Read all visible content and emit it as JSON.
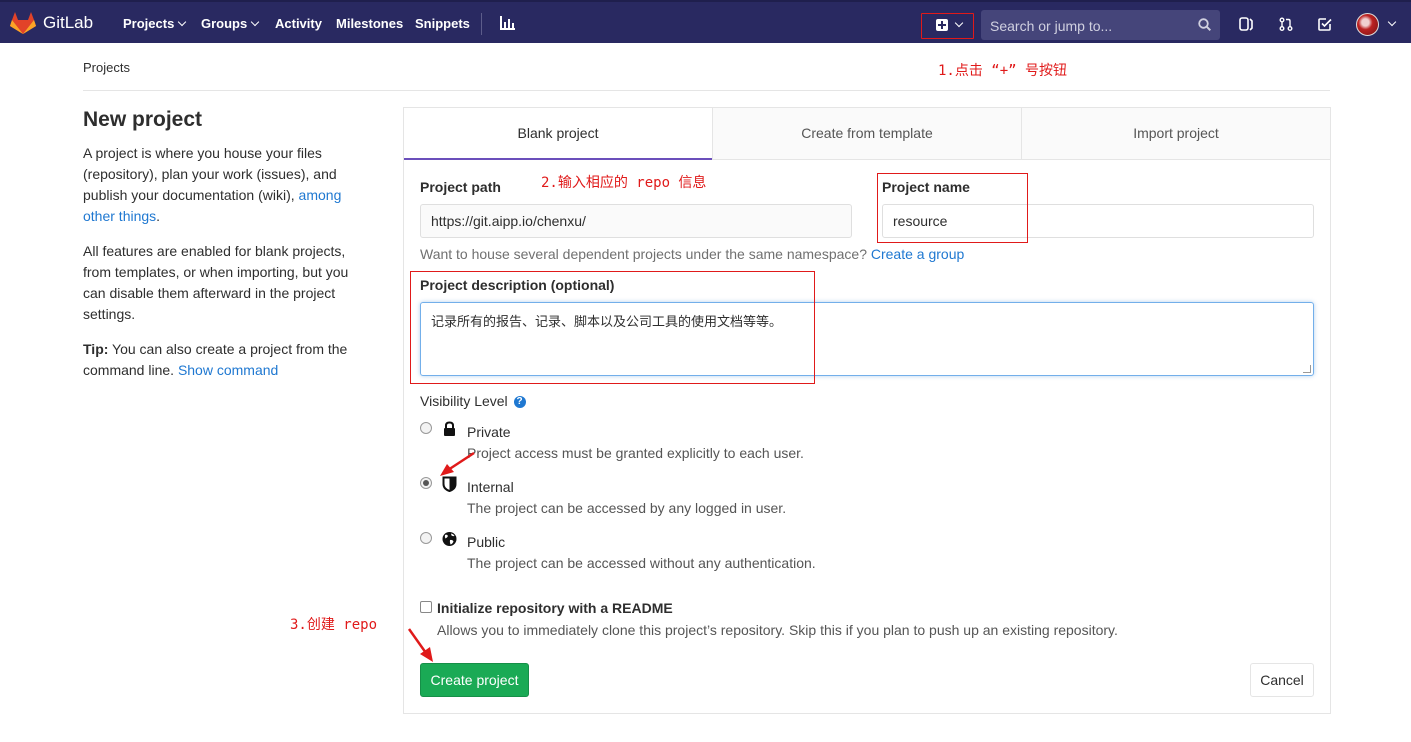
{
  "app": {
    "name": "GitLab",
    "nav": [
      "Projects",
      "Groups",
      "Activity",
      "Milestones",
      "Snippets"
    ],
    "search_placeholder": "Search or jump to..."
  },
  "breadcrumb": "Projects",
  "annotations": {
    "step1": "1.点击 “+” 号按钮",
    "step2": "2.输入相应的 repo 信息",
    "step3": "3.创建 repo"
  },
  "sidebar": {
    "title": "New project",
    "intro": "A project is where you house your files (repository), plan your work (issues), and publish your documentation (wiki),",
    "intro_link": "among other things",
    "features": "All features are enabled for blank projects, from templates, or when importing, but you can disable them afterward in the project settings.",
    "tip_label": "Tip:",
    "tip_text": "You can also create a project from the command line.",
    "tip_link": "Show command"
  },
  "tabs": [
    "Blank project",
    "Create from template",
    "Import project"
  ],
  "form": {
    "path_label": "Project path",
    "path_value": "https://git.aipp.io/chenxu/",
    "name_label": "Project name",
    "name_value": "resource",
    "group_help": "Want to house several dependent projects under the same namespace?",
    "group_link": "Create a group",
    "desc_label": "Project description (optional)",
    "desc_value": "记录所有的报告、记录、脚本以及公司工具的使用文档等等。",
    "visibility_label": "Visibility Level",
    "visibility": [
      {
        "label": "Private",
        "desc": "Project access must be granted explicitly to each user.",
        "selected": false,
        "icon": "lock-icon"
      },
      {
        "label": "Internal",
        "desc": "The project can be accessed by any logged in user.",
        "selected": true,
        "icon": "shield-icon"
      },
      {
        "label": "Public",
        "desc": "The project can be accessed without any authentication.",
        "selected": false,
        "icon": "globe-icon"
      }
    ],
    "readme_label": "Initialize repository with a README",
    "readme_desc": "Allows you to immediately clone this project’s repository. Skip this if you plan to push up an existing repository.",
    "create_label": "Create project",
    "cancel_label": "Cancel"
  },
  "colors": {
    "nav_bg": "#292961",
    "accent": "#6b4fbb",
    "create_btn": "#1aaa55",
    "link": "#1f78d1",
    "annotation": "#e01a1a"
  }
}
